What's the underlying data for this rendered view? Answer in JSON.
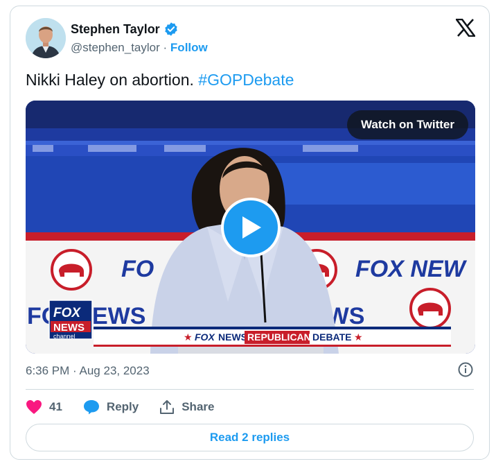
{
  "author": {
    "name": "Stephen Taylor",
    "handle": "@stephen_taylor",
    "separator": "·",
    "follow_label": "Follow",
    "avatar_icon": "avatar-photo",
    "verified_icon": "verified-badge-icon"
  },
  "tweet": {
    "text": "Nikki Haley on abortion.",
    "hashtag": "#GOPDebate"
  },
  "media": {
    "watch_label": "Watch on Twitter",
    "logo_fox": "FOX",
    "logo_news": "NEWS",
    "logo_channel": "channel",
    "banner_fox": "FOX",
    "banner_news": "NEWS",
    "banner_republican": "REPUBLICAN",
    "banner_debate": "DEBATE",
    "backdrop_left": "FO",
    "backdrop_mid": "EWS",
    "backdrop_right": "EWS",
    "backdrop_fox_a": "FO",
    "backdrop_fox_b": "FOX NEW"
  },
  "meta": {
    "time": "6:36 PM",
    "separator": "·",
    "date": "Aug 23, 2023"
  },
  "actions": {
    "like_count": "41",
    "reply_label": "Reply",
    "share_label": "Share"
  },
  "footer": {
    "read_replies_label": "Read 2 replies"
  },
  "colors": {
    "accent": "#1d9bf0",
    "like": "#f91880",
    "text_secondary": "#536471"
  }
}
